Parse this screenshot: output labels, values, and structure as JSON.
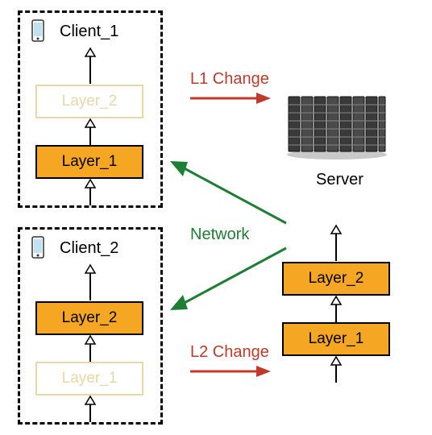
{
  "client1": {
    "title": "Client_1",
    "layer_top": "Layer_2",
    "layer_bottom": "Layer_1"
  },
  "client2": {
    "title": "Client_2",
    "layer_top": "Layer_2",
    "layer_bottom": "Layer_1"
  },
  "server": {
    "title": "Server",
    "layer_top": "Layer_2",
    "layer_bottom": "Layer_1"
  },
  "labels": {
    "l1_change": "L1 Change",
    "l2_change": "L2 Change",
    "network": "Network"
  }
}
